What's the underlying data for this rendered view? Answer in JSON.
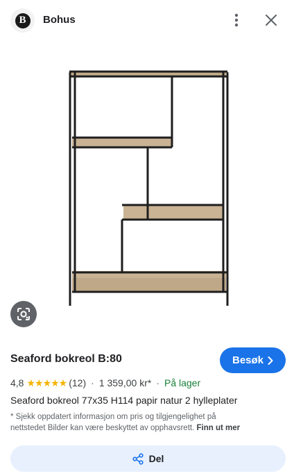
{
  "header": {
    "logo_letter": "B",
    "site_name": "Bohus",
    "more_icon": "more-vert-icon",
    "close_icon": "close-icon"
  },
  "image": {
    "alt": "Seaford bokreol B:80"
  },
  "product": {
    "title": "Seaford bokreol B:80",
    "visit_label": "Besøk",
    "rating": "4,8",
    "stars": "★★★★★",
    "review_count": "(12)",
    "separator": "·",
    "price": "1 359,00 kr*",
    "availability": "På lager",
    "description": "Seaford bokreol 77x35 H114 papir natur 2 hylleplater",
    "disclaimer_line1": "* Sjekk oppdatert informasjon om pris og tilgjengelighet på",
    "disclaimer_line2": "nettstedet Bilder kan være beskyttet av opphavsrett.",
    "learn_more": "Finn ut mer"
  },
  "actions": {
    "share_label": "Del"
  },
  "colors": {
    "accent": "#1a73e8",
    "stock_green": "#188038",
    "star": "#f4b400",
    "share_bg": "#e8f0fe"
  }
}
